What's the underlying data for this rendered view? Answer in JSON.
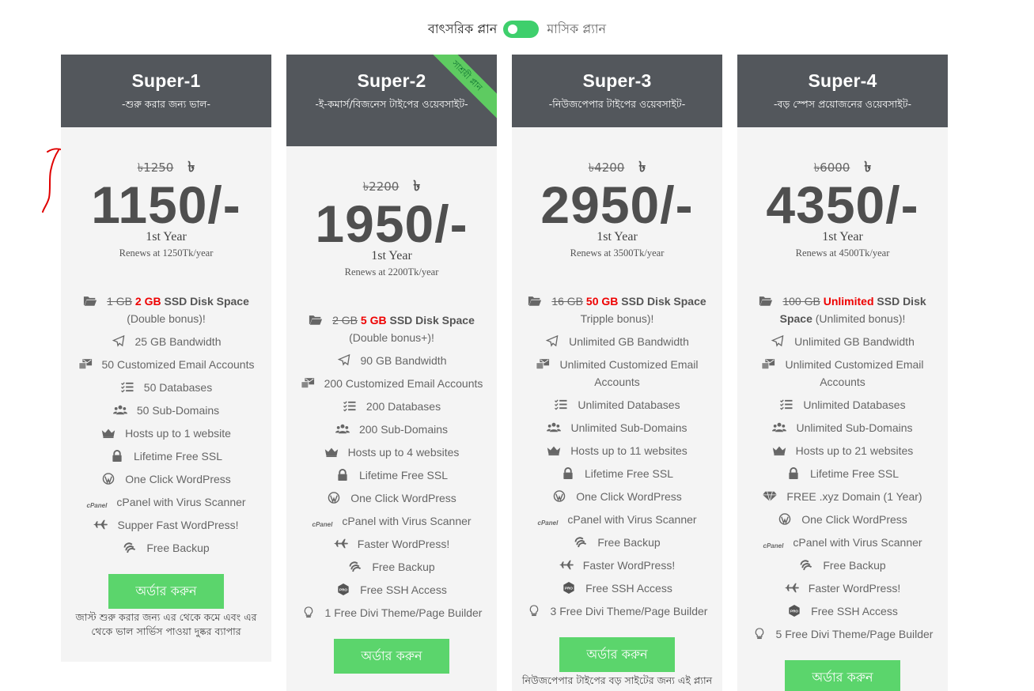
{
  "billing_toggle": {
    "yearly_label": "বাৎসরিক প্লান",
    "monthly_label": "মাসিক প্ল্যান"
  },
  "plans": [
    {
      "name": "Super-1",
      "subtitle": "-শুরু করার জন্য ভাল-",
      "old_price": "৳1250",
      "currency": "৳",
      "price": "1150/-",
      "period": "1st Year",
      "renew": "Renews at 1250Tk/year",
      "features": [
        {
          "icon": "folder-icon",
          "strike": "1 GB",
          "highlight": "2 GB",
          "bold": "SSD Disk Space",
          "text": "(Double bonus)!"
        },
        {
          "icon": "paper-plane-icon",
          "text": "25 GB Bandwidth"
        },
        {
          "icon": "email-accounts-icon",
          "text": "50 Customized Email Accounts"
        },
        {
          "icon": "database-list-icon",
          "text": "50 Databases"
        },
        {
          "icon": "users-icon",
          "text": "50 Sub-Domains"
        },
        {
          "icon": "crown-icon",
          "text": "Hosts up to 1 website"
        },
        {
          "icon": "lock-icon",
          "text": "Lifetime Free SSL"
        },
        {
          "icon": "wordpress-icon",
          "text": "One Click WordPress"
        },
        {
          "icon": "cpanel-icon",
          "text": "cPanel with Virus Scanner"
        },
        {
          "icon": "plane-icon",
          "text": "Supper Fast WordPress!"
        },
        {
          "icon": "backup-icon",
          "text": "Free Backup"
        }
      ],
      "order_label": "অর্ডার করুন",
      "note": "জাস্ট শুরু করার জন্য এর থেকে কমে এবং এর থেকে ভাল সার্ভিস পাওয়া দুষ্কর ব্যাপার"
    },
    {
      "name": "Super-2",
      "subtitle": "-ই-কমার্স/বিজনেস টাইপের ওয়েবসাইট-",
      "ribbon": "সাশ্রয়ী প্লান",
      "old_price": "৳2200",
      "currency": "৳",
      "price": "1950/-",
      "period": "1st Year",
      "renew": "Renews at 2200Tk/year",
      "features": [
        {
          "icon": "folder-icon",
          "strike": "2 GB",
          "highlight": "5 GB",
          "bold": "SSD Disk Space",
          "text": "(Double bonus+)!"
        },
        {
          "icon": "paper-plane-icon",
          "text": "90 GB Bandwidth"
        },
        {
          "icon": "email-accounts-icon",
          "text": "200 Customized Email Accounts"
        },
        {
          "icon": "database-list-icon",
          "text": "200 Databases"
        },
        {
          "icon": "users-icon",
          "text": "200 Sub-Domains"
        },
        {
          "icon": "crown-icon",
          "text": "Hosts up to 4 websites"
        },
        {
          "icon": "lock-icon",
          "text": "Lifetime Free SSL"
        },
        {
          "icon": "wordpress-icon",
          "text": "One Click WordPress"
        },
        {
          "icon": "cpanel-icon",
          "text": "cPanel with Virus Scanner"
        },
        {
          "icon": "plane-icon",
          "text": "Faster WordPress!"
        },
        {
          "icon": "backup-icon",
          "text": "Free Backup"
        },
        {
          "icon": "pro-badge-icon",
          "text": "Free SSH Access"
        },
        {
          "icon": "lightbulb-icon",
          "text": "1 Free Divi Theme/Page Builder"
        }
      ],
      "order_label": "অর্ডার করুন"
    },
    {
      "name": "Super-3",
      "subtitle": "-নিউজপেপার টাইপের ওয়েবসাইট-",
      "old_price": "৳4200",
      "currency": "৳",
      "price": "2950/-",
      "period": "1st Year",
      "renew": "Renews at 3500Tk/year",
      "features": [
        {
          "icon": "folder-icon",
          "strike": "16 GB",
          "highlight": "50 GB",
          "bold": "SSD Disk Space",
          "text": "Tripple bonus)!"
        },
        {
          "icon": "paper-plane-icon",
          "text": "Unlimited GB Bandwidth"
        },
        {
          "icon": "email-accounts-icon",
          "text": "Unlimited Customized Email Accounts"
        },
        {
          "icon": "database-list-icon",
          "text": "Unlimited Databases"
        },
        {
          "icon": "users-icon",
          "text": "Unlimited Sub-Domains"
        },
        {
          "icon": "crown-icon",
          "text": "Hosts up to 11 websites"
        },
        {
          "icon": "lock-icon",
          "text": "Lifetime Free SSL"
        },
        {
          "icon": "wordpress-icon",
          "text": "One Click WordPress"
        },
        {
          "icon": "cpanel-icon",
          "text": "cPanel with Virus Scanner"
        },
        {
          "icon": "backup-icon",
          "text": "Free Backup"
        },
        {
          "icon": "plane-icon",
          "text": "Faster WordPress!"
        },
        {
          "icon": "pro-badge-icon",
          "text": "Free SSH Access"
        },
        {
          "icon": "lightbulb-icon",
          "text": "3 Free Divi Theme/Page Builder"
        }
      ],
      "order_label": "অর্ডার করুন",
      "note": "নিউজপেপার টাইপের বড় সাইটের জন্য এই প্ল্যান"
    },
    {
      "name": "Super-4",
      "subtitle": "-বড় স্পেস প্রয়োজনের ওয়েবসাইট-",
      "old_price": "৳6000",
      "currency": "৳",
      "price": "4350/-",
      "period": "1st Year",
      "renew": "Renews at 4500Tk/year",
      "features": [
        {
          "icon": "folder-icon",
          "strike": "100 GB",
          "highlight": "Unlimited",
          "bold": "SSD Disk Space",
          "text": "(Unlimited bonus)!"
        },
        {
          "icon": "paper-plane-icon",
          "text": "Unlimited GB Bandwidth"
        },
        {
          "icon": "email-accounts-icon",
          "text": "Unlimited Customized Email Accounts"
        },
        {
          "icon": "database-list-icon",
          "text": "Unlimited Databases"
        },
        {
          "icon": "users-icon",
          "text": "Unlimited Sub-Domains"
        },
        {
          "icon": "crown-icon",
          "text": "Hosts up to 21 websites"
        },
        {
          "icon": "lock-icon",
          "text": "Lifetime Free SSL"
        },
        {
          "icon": "diamond-icon",
          "text": "FREE .xyz Domain (1 Year)"
        },
        {
          "icon": "wordpress-icon",
          "text": "One Click WordPress"
        },
        {
          "icon": "cpanel-icon",
          "text": "cPanel with Virus Scanner"
        },
        {
          "icon": "backup-icon",
          "text": "Free Backup"
        },
        {
          "icon": "plane-icon",
          "text": "Faster WordPress!"
        },
        {
          "icon": "pro-badge-icon",
          "text": "Free SSH Access"
        },
        {
          "icon": "lightbulb-icon",
          "text": "5 Free Divi Theme/Page Builder"
        }
      ],
      "order_label": "অর্ডার করুন"
    }
  ],
  "cpanel_icon_text": "cPanel",
  "pro_icon_text": "PRO",
  "colors": {
    "header": "#53575c",
    "accent_green": "#5bd56c",
    "highlight_red": "#e00000",
    "annotation_red": "#e00000"
  }
}
